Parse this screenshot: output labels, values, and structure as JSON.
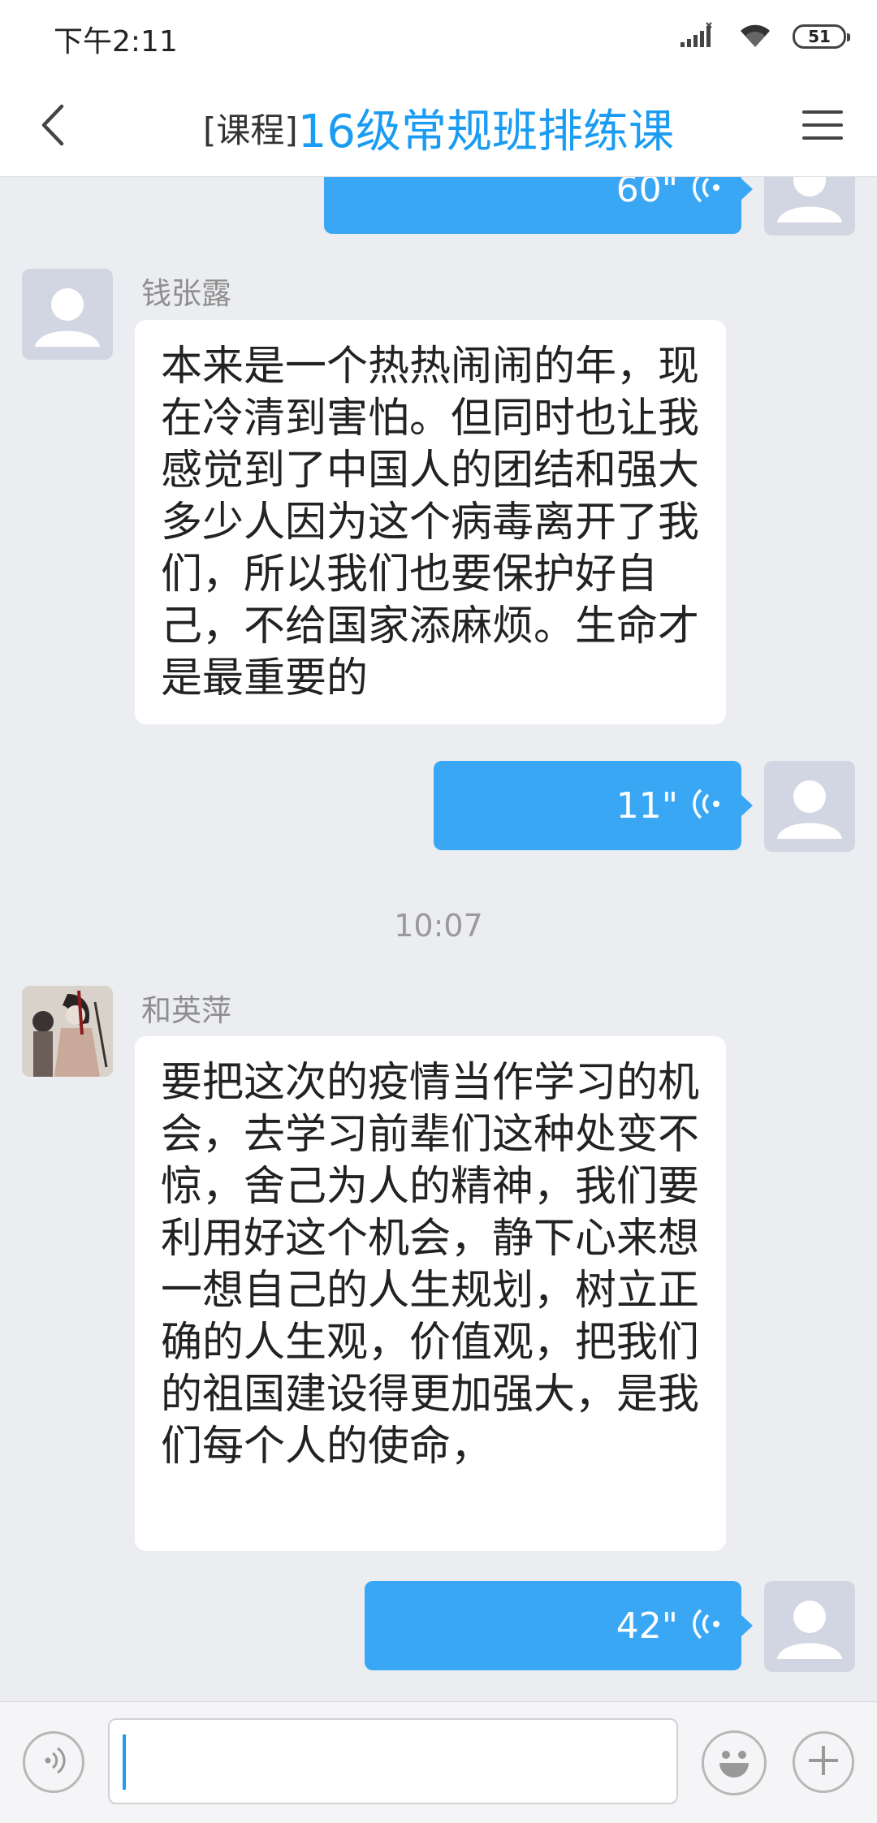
{
  "status_bar": {
    "time": "下午2:11",
    "battery": "51"
  },
  "header": {
    "title_tag": "[课程]",
    "title": "16级常规班排练课"
  },
  "messages": {
    "voice_1_duration": "60\"",
    "msg_1": {
      "sender": "钱张露",
      "text": "本来是一个热热闹闹的年，现在冷清到害怕。但同时也让我感觉到了中国人的团结和强大多少人因为这个病毒离开了我们，所以我们也要保护好自己，不给国家添麻烦。生命才是最重要的"
    },
    "voice_2_duration": "11\"",
    "timestamp": "10:07",
    "msg_2": {
      "sender": "和英萍",
      "text": "要把这次的疫情当作学习的机会，去学习前辈们这种处变不惊，舍己为人的精神，我们要利用好这个机会，静下心来想一想自己的人生规划，树立正确的人生观，价值观，把我们的祖国建设得更加强大，是我们每个人的使命，"
    },
    "voice_3_duration": "42\""
  },
  "input_bar": {
    "value": ""
  },
  "colors": {
    "accent": "#1a9cf2",
    "voice_bubble": "#3aa7f5",
    "chat_background": "#ebedf0"
  },
  "icons": {
    "back": "chevron-left-icon",
    "menu": "hamburger-menu-icon",
    "voice_input": "speaker-icon",
    "emoji": "smiley-icon",
    "more": "plus-icon",
    "voice_wave": "voice-wave-icon"
  }
}
